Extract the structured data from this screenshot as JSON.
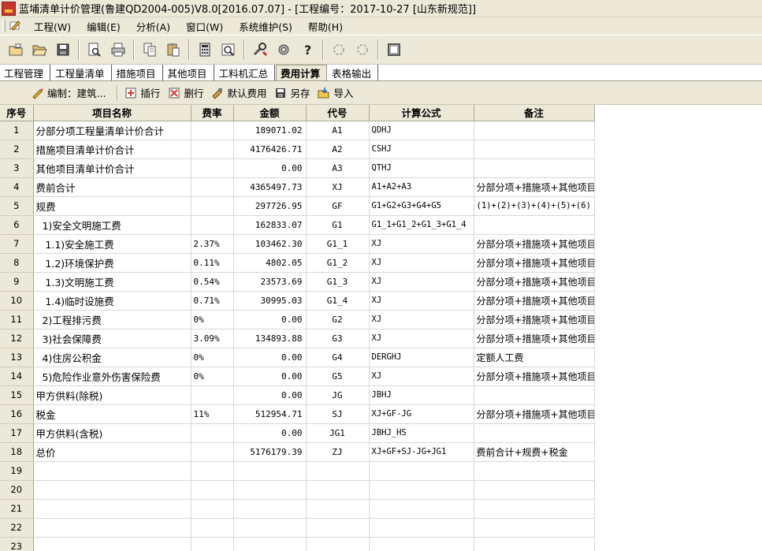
{
  "window": {
    "title": "蓝埔清单计价管理(鲁建QD2004-005)V8.0[2016.07.07] - [工程编号：2017-10-27 [山东新规范]]"
  },
  "menu": [
    "工程(W)",
    "编辑(E)",
    "分析(A)",
    "窗口(W)",
    "系统维护(S)",
    "帮助(H)"
  ],
  "tabs": [
    "工程管理",
    "工程量清单",
    "措施项目",
    "其他项目",
    "工料机汇总",
    "费用计算",
    "表格输出"
  ],
  "active_tab": "费用计算",
  "subtoolbar": {
    "edit": "编制：建筑...",
    "insert": "插行",
    "delete": "删行",
    "default": "默认费用",
    "saveas": "另存",
    "import": "导入"
  },
  "columns": [
    "序号",
    "项目名称",
    "费率",
    "金额",
    "代号",
    "计算公式",
    "备注"
  ],
  "rows": [
    {
      "seq": "1",
      "name": "分部分项工程量清单计价合计",
      "rate": "",
      "amount": "189071.02",
      "code": "A1",
      "formula": "QDHJ",
      "note": ""
    },
    {
      "seq": "2",
      "name": "措施项目清单计价合计",
      "rate": "",
      "amount": "4176426.71",
      "code": "A2",
      "formula": "CSHJ",
      "note": ""
    },
    {
      "seq": "3",
      "name": "其他项目清单计价合计",
      "rate": "",
      "amount": "0.00",
      "code": "A3",
      "formula": "QTHJ",
      "note": ""
    },
    {
      "seq": "4",
      "name": "费前合计",
      "rate": "",
      "amount": "4365497.73",
      "code": "XJ",
      "formula": "A1+A2+A3",
      "note": "分部分项+措施项+其他项目"
    },
    {
      "seq": "5",
      "name": "规费",
      "rate": "",
      "amount": "297726.95",
      "code": "GF",
      "formula": "G1+G2+G3+G4+G5",
      "note": "(1)+(2)+(3)+(4)+(5)+(6)"
    },
    {
      "seq": "6",
      "name": "  1)安全文明施工费",
      "rate": "",
      "amount": "162833.07",
      "code": "G1",
      "formula": "G1_1+G1_2+G1_3+G1_4",
      "note": ""
    },
    {
      "seq": "7",
      "name": "   1.1)安全施工费",
      "rate": "2.37%",
      "amount": "103462.30",
      "code": "G1_1",
      "formula": "XJ",
      "note": "分部分项+措施项+其他项目"
    },
    {
      "seq": "8",
      "name": "   1.2)环境保护费",
      "rate": "0.11%",
      "amount": "4802.05",
      "code": "G1_2",
      "formula": "XJ",
      "note": "分部分项+措施项+其他项目"
    },
    {
      "seq": "9",
      "name": "   1.3)文明施工费",
      "rate": "0.54%",
      "amount": "23573.69",
      "code": "G1_3",
      "formula": "XJ",
      "note": "分部分项+措施项+其他项目"
    },
    {
      "seq": "10",
      "name": "   1.4)临时设施费",
      "rate": "0.71%",
      "amount": "30995.03",
      "code": "G1_4",
      "formula": "XJ",
      "note": "分部分项+措施项+其他项目"
    },
    {
      "seq": "11",
      "name": "  2)工程排污费",
      "rate": "0%",
      "amount": "0.00",
      "code": "G2",
      "formula": "XJ",
      "note": "分部分项+措施项+其他项目"
    },
    {
      "seq": "12",
      "name": "  3)社会保障费",
      "rate": "3.09%",
      "amount": "134893.88",
      "code": "G3",
      "formula": "XJ",
      "note": "分部分项+措施项+其他项目"
    },
    {
      "seq": "13",
      "name": "  4)住房公积金",
      "rate": "0%",
      "amount": "0.00",
      "code": "G4",
      "formula": "DERGHJ",
      "note": "定额人工费"
    },
    {
      "seq": "14",
      "name": "  5)危险作业意外伤害保险费",
      "rate": "0%",
      "amount": "0.00",
      "code": "G5",
      "formula": "XJ",
      "note": "分部分项+措施项+其他项目"
    },
    {
      "seq": "15",
      "name": "甲方供料(除税)",
      "rate": "",
      "amount": "0.00",
      "code": "JG",
      "formula": "JBHJ",
      "note": ""
    },
    {
      "seq": "16",
      "name": "税金",
      "rate": "11%",
      "amount": "512954.71",
      "code": "SJ",
      "formula": "XJ+GF-JG",
      "note": "分部分项+措施项+其他项目+"
    },
    {
      "seq": "17",
      "name": "甲方供料(含税)",
      "rate": "",
      "amount": "0.00",
      "code": "JG1",
      "formula": "JBHJ_HS",
      "note": ""
    },
    {
      "seq": "18",
      "name": "总价",
      "rate": "",
      "amount": "5176179.39",
      "code": "ZJ",
      "formula": "XJ+GF+SJ-JG+JG1",
      "note": "费前合计+规费+税金"
    },
    {
      "seq": "19",
      "name": "",
      "rate": "",
      "amount": "",
      "code": "",
      "formula": "",
      "note": ""
    },
    {
      "seq": "20",
      "name": "",
      "rate": "",
      "amount": "",
      "code": "",
      "formula": "",
      "note": ""
    },
    {
      "seq": "21",
      "name": "",
      "rate": "",
      "amount": "",
      "code": "",
      "formula": "",
      "note": ""
    },
    {
      "seq": "22",
      "name": "",
      "rate": "",
      "amount": "",
      "code": "",
      "formula": "",
      "note": ""
    },
    {
      "seq": "23",
      "name": "",
      "rate": "",
      "amount": "",
      "code": "",
      "formula": "",
      "note": ""
    }
  ]
}
